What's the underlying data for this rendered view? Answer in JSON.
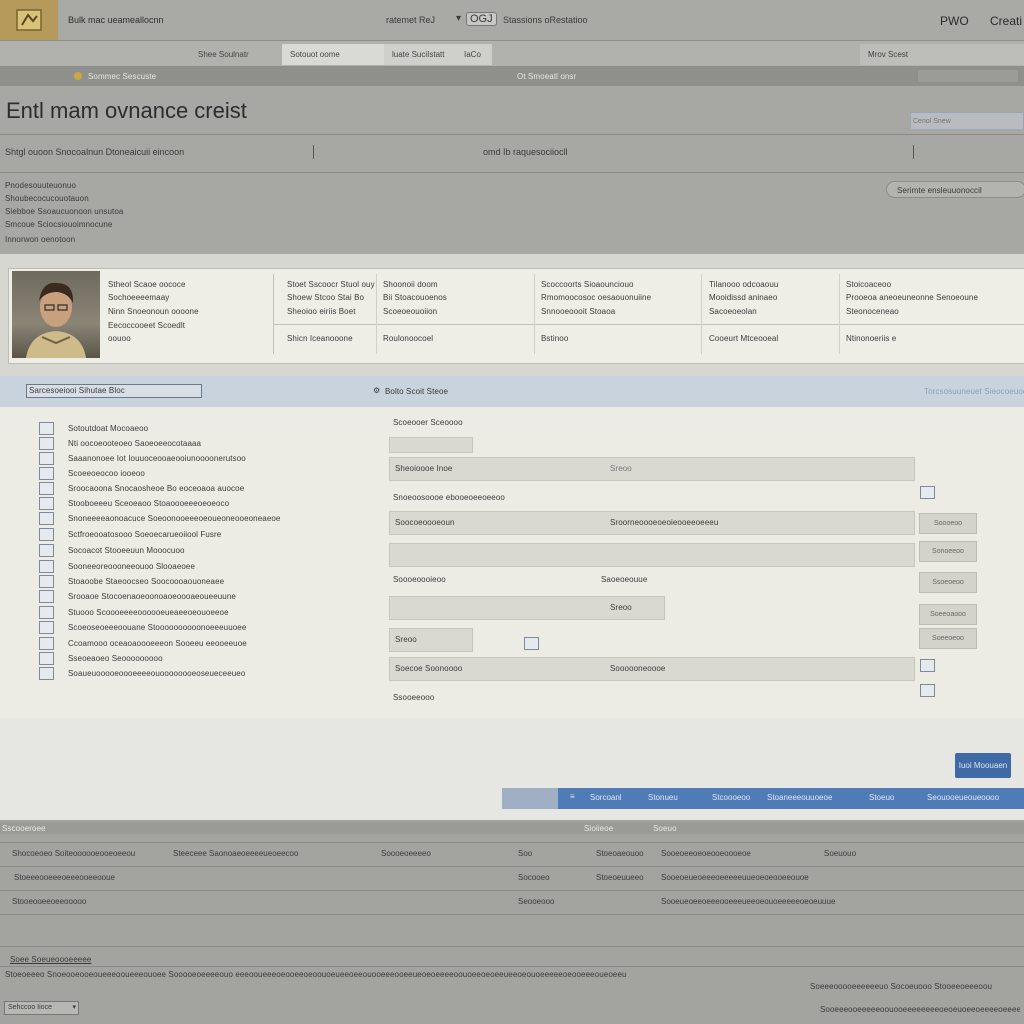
{
  "header": {
    "app_title": "Bulk  mac ueameallocnn",
    "center_label": "ratemet  ReJ",
    "center_badge": "OGJ",
    "center_sub": "Stassions oRestatioo",
    "right_a": "PWO",
    "right_b": "Creati"
  },
  "tabs": [
    "Shee Soulnatr",
    "Sotouot oome",
    "luate SuciIstatt",
    "Mrov Scest",
    "IaCo"
  ],
  "subbar": {
    "label": "Sommec Sescuste",
    "center": "Ot Smoeatl onsr"
  },
  "page": {
    "title": "Entl mam ovnance creist",
    "search_placeholder": "Cenol Snew",
    "subtitle": "Shtgl ouoon Snocoalnun Dtoneaicuii eincoon",
    "subtitle_right": "omd Ib raquesociiocll",
    "meta_lines": [
      "Pnodesouuteuonuo",
      "Shoubecocucouotauon",
      "Siebboe Ssoaucuonoon unsutoa",
      "Smcoue Sciocsiouoimnocune",
      "Innorwon oenotoon"
    ],
    "pill_button": "Serimte ensleuuonoccil"
  },
  "profile": {
    "lines": [
      "Stheol Scaoe oococe",
      "Sochoeeeemaay",
      "Ninn Snoeonoun oooone",
      "Eecoccooeet Scoedlt",
      "oouoo"
    ],
    "grid": [
      [
        "Stoet Sscoocr  Stuol ouy",
        "Shoonoii doom",
        "Scoccoorts Sioaounciouo",
        "Tilanooo odcoaouu",
        "Stoicoaceoo"
      ],
      [
        "Shoew Stcoo  Stai  Bo",
        "Bii Stoacouoenos",
        "Rmomoocosoc oesaouonuiine",
        "Mooidissd aninaeo",
        "Prooeoa aneoeuneonne Senoeoune"
      ],
      [
        "Sheoioo  eiriis  Boet",
        "Scoeoeouoiion",
        "Snnooeoooit Stoaoa",
        "Sacoeoeolan",
        "Steonoceneao"
      ],
      [
        "Shicn Iceanooone",
        "Roulonoocoel",
        "Bstinoo",
        "Cooeurt Mtceooeal",
        "Ntinonoeriis e"
      ]
    ]
  },
  "form": {
    "header_box": "Sarcesoeiooi Sihutae Bloc",
    "header_center": "Bolto Scoit Steoe",
    "header_right": "Torcsosuuneuet Sieocoeuooo",
    "list": [
      "Sotoutdoat Mocoaeoo",
      "Nti oocoeooteoeo Saoeoeeocotaaaa",
      "Saaanonoee Iot Iouuoceooaeooiunoooonerutsoo",
      "Scoeeoeocoo iooeoo",
      "Sroocaoona Snocaosheoe Bo eoceoaoa auocoe",
      "Stooboeeeu Sceoeaoo Stoaoooeeeoeoeoco",
      "Snoneeeeaonoacuce Soeoonooeeeoeoueoneooeoneaeoe",
      "Sctfroeooatosooo Soeoecarueoiiool Fusre",
      "Socoacot Stooeeuun Mooocuoo",
      "Sooneeoreoooneeouoo Slooaeoee",
      "Stoaoobe Staeoocseo Soocoooaouoneaee",
      "Srooaoe Stocoenaoeoonoaoeoooaeoueeuune",
      "Stuooo Scoooeeeeoooooeueaeeoeouoeeoe",
      "Scoeoseoeeeoouane Stoooooooooonoeeeuuoee",
      "Ccoamooo oceaoaoooeeeon Sooeeu eeooeeuoe",
      "Sseoeaoeo Seooooooooo",
      "Soaueuooooeoooeeeeouoooooooeoseueceeueo"
    ],
    "field_labels": [
      "Scoeooer Sceoooo",
      "Sheoioooe Inoe",
      "Snoeoosoooe ebooeoeeoeeoo",
      "Sreoo",
      "Soocoeoooeoun",
      "Sroorneoooeoeoieooeeoeeeu",
      "Soooeoooieoo",
      "Saoeoeouue",
      "Soecoe Soonoooo",
      "Soooooneoooe",
      "Ssooeeooo"
    ],
    "side_buttons": [
      "Soooeoo",
      "Sonoeeoo",
      "Ssoeoeoo",
      "Soeeoaooo",
      "Soeeoeoo"
    ]
  },
  "actions": {
    "submit": "Iuoi Moouaen",
    "steps": [
      "Sorcoanl",
      "Stonueu",
      "Stcoooeoo",
      "Stoaneeeouuoeoe",
      "Stoeuo",
      "Seouooeueoueoooo"
    ]
  },
  "table": {
    "bar_label": "Sscooeroee",
    "bar_center": "Sioiieoe",
    "bar_center2": "Soeuo",
    "rows": [
      [
        "Shocoeoeo Soiteoooooeooeoeeou",
        "Steeceee Saonoaeoeeeeueoeecoo",
        "Soooeoeeeeo",
        "Soo",
        "Stoeoaeouoo",
        "Sooeoeeoeoeooeoooeoe",
        "Soeuouo"
      ],
      [
        "Stoeeeooeeeoeeeooeeooue",
        "",
        "",
        "Socooeo",
        "Stoeoeuueeo",
        "Sooeoeueoeeeoeeeeeuueoeoeooeeouoe",
        ""
      ],
      [
        "Stooeooeeoeeooooo",
        "",
        "",
        "Seooeooo",
        "",
        "Sooeueoeeoeeeooeeeueeoeouoeeeeeoeoeuuue",
        ""
      ]
    ],
    "footer_a": "Soee Soeueoooeeeee",
    "footer_lines": [
      "Stoeoeeeo Snoeooeooeoueeeooueeeouoee Sooooeoeeeeouo eeeooueeeoeooeeoeoouoeueeoeeouooeeeooeeueoeoeeeeoouoeeoeoeeueeoeouoeeeeeoeooeeeoueoeeu",
      "Soeeeooooeeeeeeuo  Socoeuooo  Stooeeoeeeoou",
      "Sooeeeooeeeeeoouooeeeeeeeeoeoeuoeeoeeeeoeeeeueoeoeeeuee"
    ],
    "dropdown_value": "Sehccoo  Iioce"
  },
  "colors": {
    "accent": "#4f7bb7",
    "logo": "#b59a5c",
    "form_header": "#c9d3dd"
  }
}
